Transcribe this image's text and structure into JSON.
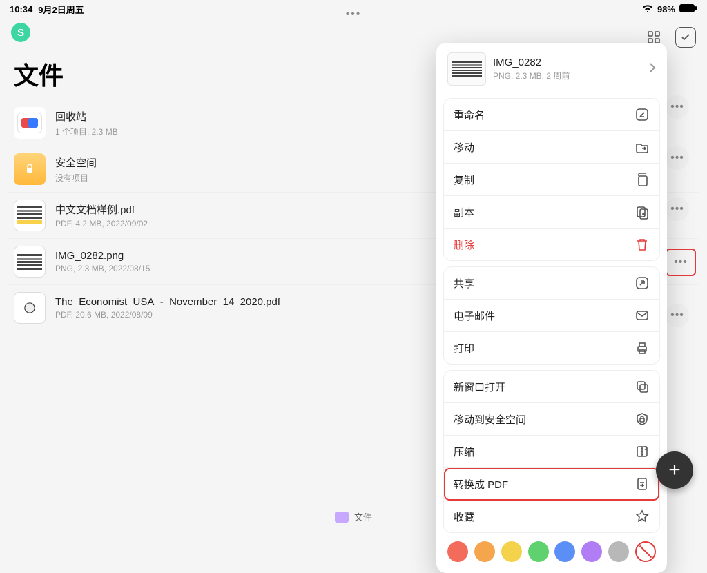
{
  "status": {
    "time": "10:34",
    "date": "9月2日周五",
    "battery": "98%"
  },
  "avatar_letter": "S",
  "header": {
    "more": "•••"
  },
  "page_title": "文件",
  "files": [
    {
      "name": "回收站",
      "meta": "1 个项目, 2.3 MB"
    },
    {
      "name": "安全空间",
      "meta": "没有项目"
    },
    {
      "name": "中文文档样例.pdf",
      "meta": "PDF, 4.2 MB, 2022/09/02"
    },
    {
      "name": "IMG_0282.png",
      "meta": "PNG, 2.3 MB, 2022/08/15"
    },
    {
      "name": "The_Economist_USA_-_November_14_2020.pdf",
      "meta": "PDF, 20.6 MB, 2022/08/09"
    }
  ],
  "bottom_tab": "文件",
  "sheet": {
    "title": "IMG_0282",
    "sub": "PNG, 2.3 MB, 2 周前",
    "group1": [
      {
        "label": "重命名",
        "icon": "rename"
      },
      {
        "label": "移动",
        "icon": "move"
      },
      {
        "label": "复制",
        "icon": "copy"
      },
      {
        "label": "副本",
        "icon": "duplicate"
      },
      {
        "label": "删除",
        "icon": "trash",
        "danger": true
      }
    ],
    "group2": [
      {
        "label": "共享",
        "icon": "share"
      },
      {
        "label": "电子邮件",
        "icon": "mail"
      },
      {
        "label": "打印",
        "icon": "print"
      }
    ],
    "group3": [
      {
        "label": "新窗口打开",
        "icon": "window"
      },
      {
        "label": "移动到安全空间",
        "icon": "lock"
      },
      {
        "label": "压缩",
        "icon": "archive"
      },
      {
        "label": "转换成 PDF",
        "icon": "convert",
        "highlight": true
      },
      {
        "label": "收藏",
        "icon": "star"
      }
    ],
    "colors": [
      "#f26b5b",
      "#f5a54b",
      "#f5d24b",
      "#5fd26f",
      "#5b8ff5",
      "#b07df5",
      "#b8b8b8"
    ]
  }
}
